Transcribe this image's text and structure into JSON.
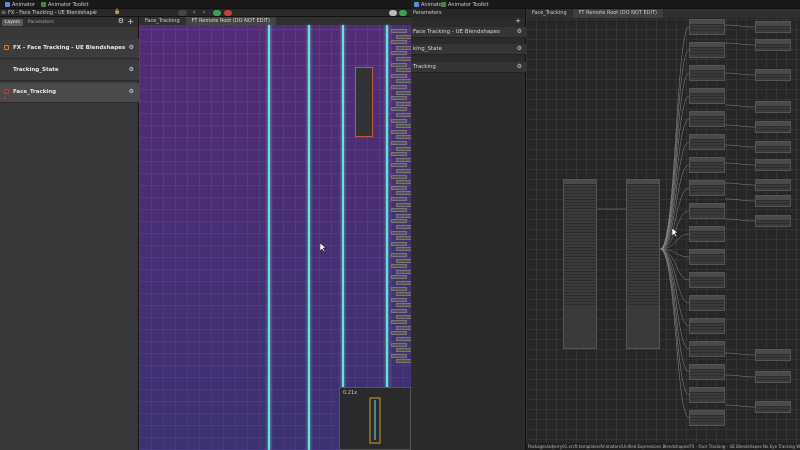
{
  "window_tabs": [
    {
      "label": "Animator",
      "icon": "animator-icon"
    },
    {
      "label": "Animator Toolkit",
      "icon": "toolkit-icon"
    }
  ],
  "animator_toolbar": {
    "breadcrumb": "FX - Face Tracking - UE Blendshap⊕"
  },
  "layers_panel": {
    "tabs": [
      "Layers",
      "Parameters"
    ],
    "active_tab": "Layers",
    "add_label": "+",
    "layers": [
      {
        "name": "FX - Face Tracking - UE Blendshapes",
        "selected": false
      },
      {
        "name": "Tracking_State",
        "selected": false
      },
      {
        "name": "Face_Tracking",
        "selected": true
      }
    ]
  },
  "graph_left": {
    "breadcrumbs": [
      "Face_Tracking",
      "FT Remote Root (DO NOT EDIT)"
    ],
    "minimap_zoom": "0.21x"
  },
  "middle_panel": {
    "header": "Parameters",
    "rows": [
      {
        "name": "Face Tracking - UE Blendshapes"
      },
      {
        "name": "king_State"
      },
      {
        "name": "Tracking"
      }
    ]
  },
  "graph_right": {
    "breadcrumbs": [
      "Face_Tracking",
      "FT Remote Root (DO NOT EDIT)"
    ],
    "status_path": "Packages/adjerry91.vrcft.templates/Animators/Unified Expressions Blendshapes/FX - Face Tracking - UE Blendshapes No Eye Tracking WD"
  },
  "colors": {
    "graph_purple": "#4a2a6e",
    "transition_cyan": "#6fe0d8",
    "toolbar_green": "#3aa35a",
    "toolbar_red": "#c04040"
  }
}
